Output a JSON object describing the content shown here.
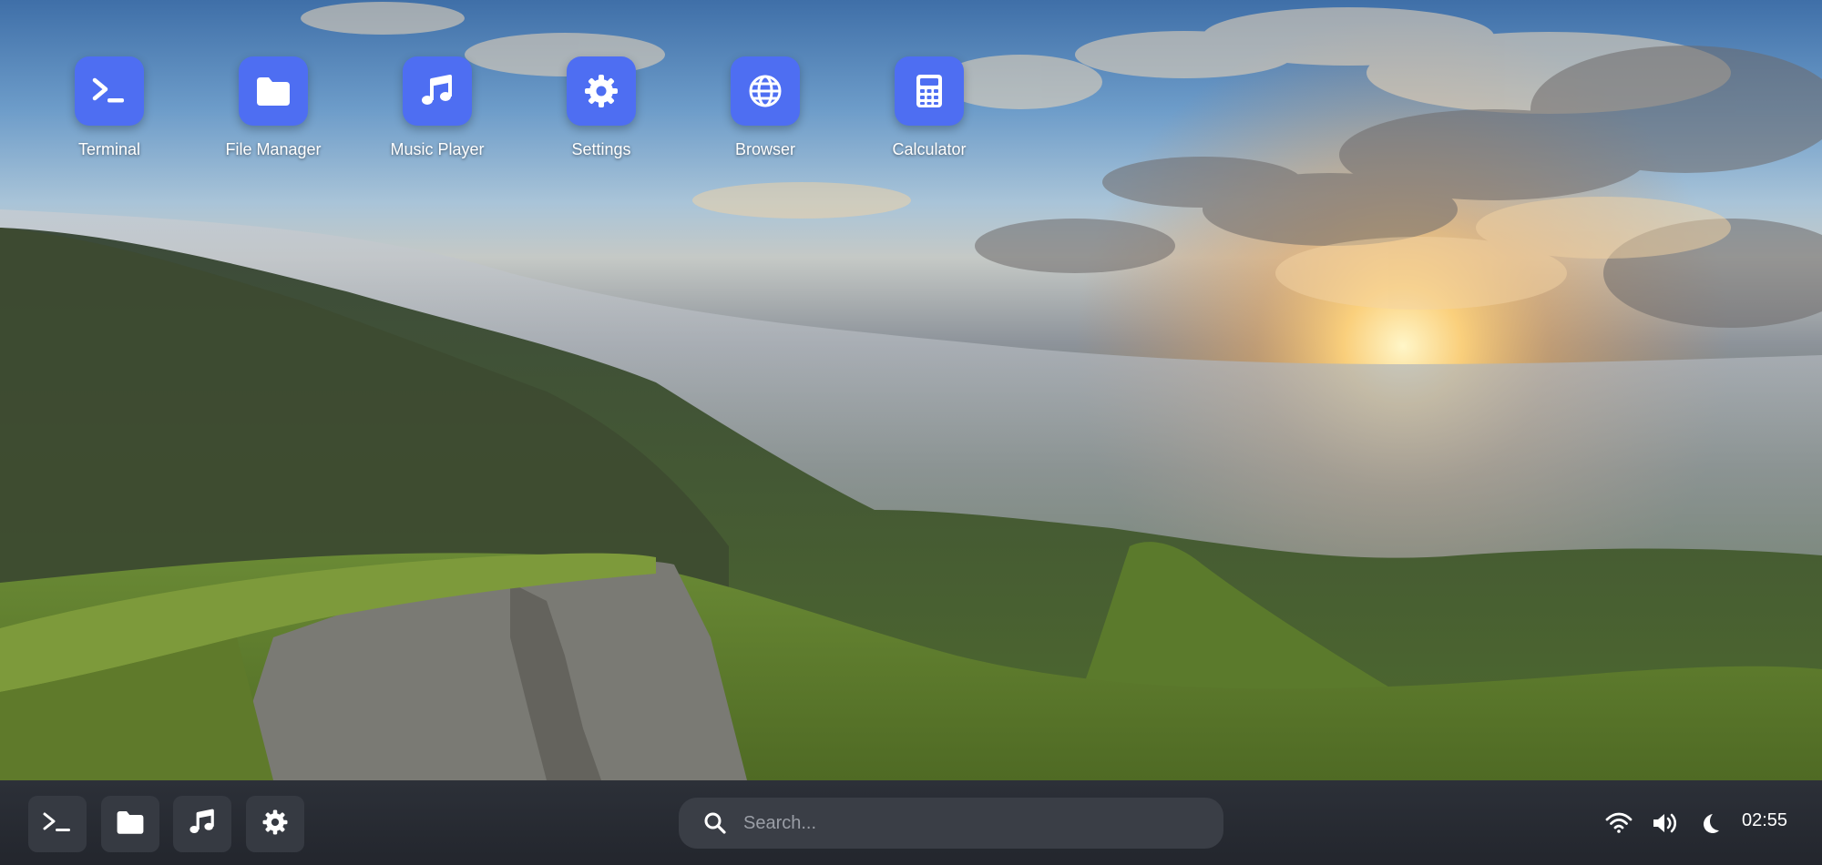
{
  "desktop": {
    "apps": [
      {
        "label": "Terminal",
        "icon": "terminal-icon"
      },
      {
        "label": "File Manager",
        "icon": "folder-icon"
      },
      {
        "label": "Music Player",
        "icon": "music-note-icon"
      },
      {
        "label": "Settings",
        "icon": "gear-icon"
      },
      {
        "label": "Browser",
        "icon": "globe-icon"
      },
      {
        "label": "Calculator",
        "icon": "calculator-icon"
      }
    ],
    "wallpaper": "misty green mountains at sunrise"
  },
  "taskbar": {
    "pinned": [
      "terminal-icon",
      "folder-icon",
      "music-note-icon",
      "gear-icon"
    ],
    "search": {
      "placeholder": "Search..."
    },
    "tray": [
      "wifi-icon",
      "volume-icon",
      "moon-icon"
    ],
    "clock": "02:55"
  },
  "colors": {
    "accent": "#4e6ef2",
    "taskbar_bg": "#2a2d34",
    "task_button_bg": "#363a42",
    "search_bg": "#3a3e46"
  }
}
